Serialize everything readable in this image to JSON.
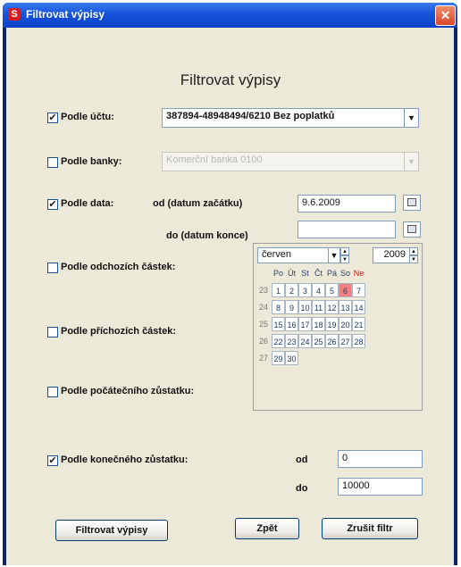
{
  "window": {
    "title": "Filtrovat výpisy",
    "close_glyph": "✕",
    "icon_glyph": "S"
  },
  "dialog": {
    "heading": "Filtrovat výpisy"
  },
  "filters": {
    "account": {
      "label": "Podle účtu:",
      "checked": true,
      "value": "387894-48948494/6210   Bez poplatků"
    },
    "bank": {
      "label": "Podle banky:",
      "checked": false,
      "value": "Komerční banka  0100"
    },
    "date": {
      "label": "Podle data:",
      "checked": true,
      "from_label": "od (datum začátku)",
      "from_value": "9.6.2009",
      "to_label": "do (datum konce)",
      "to_value": ""
    },
    "outgoing": {
      "label": "Podle odchozích částek:",
      "checked": false
    },
    "incoming": {
      "label": "Podle příchozích částek:",
      "checked": false
    },
    "initial_balance": {
      "label": "Podle počátečního zůstatku:",
      "checked": false
    },
    "final_balance": {
      "label": "Podle konečného zůstatku:",
      "checked": true,
      "from_label": "od",
      "from_value": "0",
      "to_label": "do",
      "to_value": "10000"
    }
  },
  "calendar": {
    "month": "červen",
    "year": "2009",
    "weekdays": [
      "Po",
      "Út",
      "St",
      "Čt",
      "Pá",
      "So",
      "Ne"
    ],
    "weeks": [
      {
        "no": "23",
        "days": [
          "1",
          "2",
          "3",
          "4",
          "5",
          "6",
          "7"
        ]
      },
      {
        "no": "24",
        "days": [
          "8",
          "9",
          "10",
          "11",
          "12",
          "13",
          "14"
        ]
      },
      {
        "no": "25",
        "days": [
          "15",
          "16",
          "17",
          "18",
          "19",
          "20",
          "21"
        ]
      },
      {
        "no": "26",
        "days": [
          "22",
          "23",
          "24",
          "25",
          "26",
          "27",
          "28"
        ]
      },
      {
        "no": "27",
        "days": [
          "29",
          "30"
        ]
      }
    ],
    "selected_day": "6",
    "sunday_color": "#d01010",
    "today_color": "#f08080"
  },
  "buttons": {
    "filter": "Filtrovat výpisy",
    "back": "Zpět",
    "clear": "Zrušit filtr"
  },
  "glyphs": {
    "check": "✔",
    "arrow_down": "▼",
    "spin_up": "▲",
    "spin_down": "▼"
  }
}
